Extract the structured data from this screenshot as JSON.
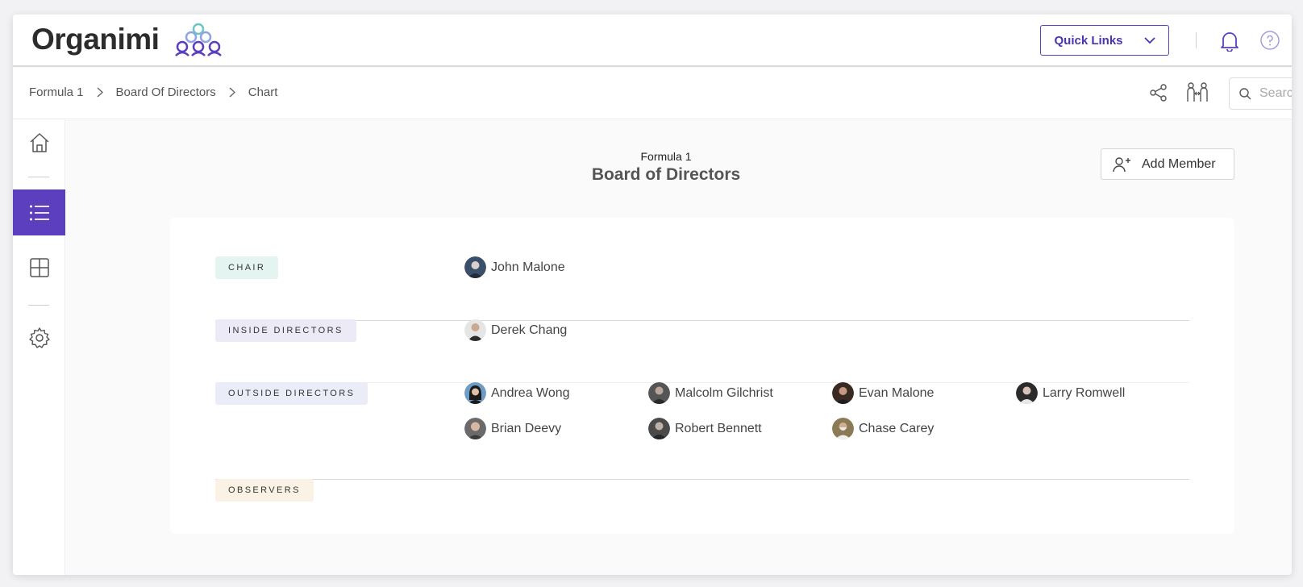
{
  "brand": {
    "name": "Organimi"
  },
  "header": {
    "quick_links_label": "Quick Links"
  },
  "breadcrumb": [
    "Formula 1",
    "Board Of Directors",
    "Chart"
  ],
  "search": {
    "placeholder": "Search"
  },
  "page": {
    "subtitle": "Formula 1",
    "title": "Board of Directors",
    "add_member_label": "Add Member"
  },
  "colors": {
    "accent": "#5b3fbf",
    "chair_badge": "#e3f4f1",
    "inside_badge": "#eceaf7",
    "outside_badge": "#eaedf7",
    "observers_badge": "#faf3e5"
  },
  "sections": [
    {
      "label": "CHAIR",
      "members": [
        "John Malone"
      ]
    },
    {
      "label": "INSIDE DIRECTORS",
      "members": [
        "Derek Chang"
      ]
    },
    {
      "label": "OUTSIDE DIRECTORS",
      "members": [
        "Andrea Wong",
        "Malcolm Gilchrist",
        "Evan Malone",
        "Larry Romwell",
        "Brian Deevy",
        "Robert Bennett",
        "Chase Carey"
      ]
    },
    {
      "label": "OBSERVERS",
      "members": []
    }
  ],
  "sidebar": {
    "items": [
      "home-icon",
      "list-icon",
      "grid-icon",
      "gear-icon"
    ]
  }
}
